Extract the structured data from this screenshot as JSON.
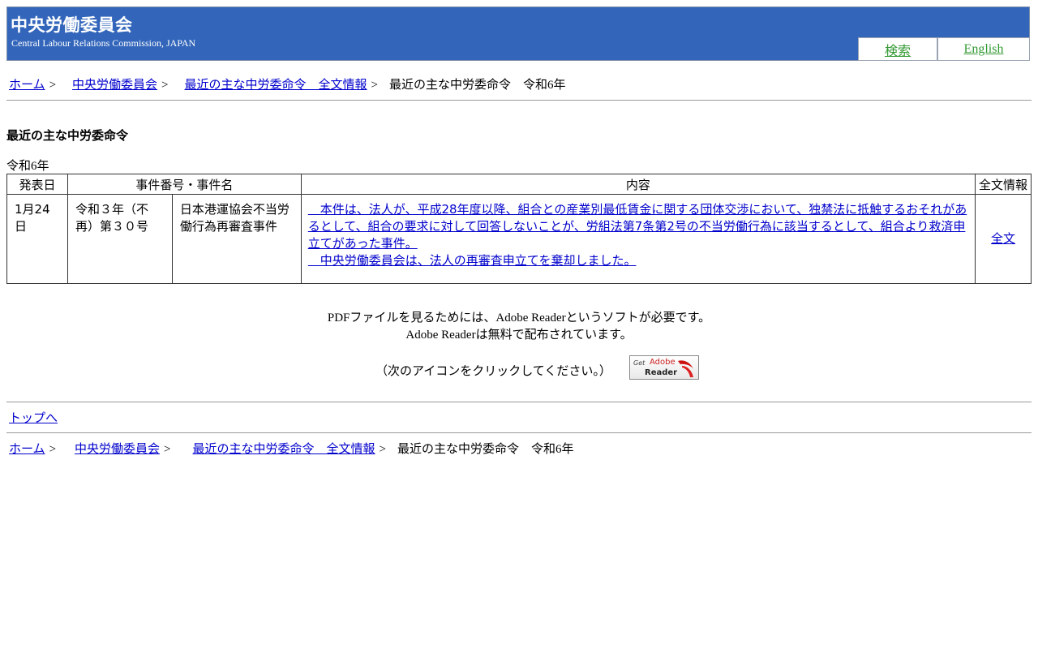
{
  "header": {
    "title": "中央労働委員会",
    "subtitle": "Central Labour Relations Commission, JAPAN",
    "search_label": "検索",
    "english_label": "English"
  },
  "breadcrumb": {
    "home": "ホーム",
    "commission": "中央労働委員会",
    "orders": "最近の主な中労委命令　全文情報",
    "current": "最近の主な中労委命令　令和6年",
    "separator": ">"
  },
  "page": {
    "heading": "最近の主な中労委命令",
    "year": "令和6年"
  },
  "table": {
    "headers": {
      "date": "発表日",
      "case": "事件番号・事件名",
      "content": "内容",
      "full_text": "全文情報"
    },
    "rows": [
      {
        "date": "1月24日",
        "case_number": "令和３年（不再）第３０号",
        "case_name": "日本港運協会不当労働行為再審査事件",
        "content_p1": "　本件は、法人が、平成28年度以降、組合との産業別最低賃金に関する団体交渉において、独禁法に抵触するおそれがあるとして、組合の要求に対して回答しないことが、労組法第7条第2号の不当労働行為に該当するとして、組合より救済申立てがあった事件。",
        "content_p2": "　中央労働委員会は、法人の再審査申立てを棄却しました。",
        "full_text_link": "全文"
      }
    ]
  },
  "pdf_note": {
    "line1": "PDFファイルを見るためには、Adobe Readerというソフトが必要です。",
    "line2": "Adobe Readerは無料で配布されています。",
    "click": "（次のアイコンをクリックしてください。）",
    "badge_get": "Get",
    "badge_brand": "Adobe",
    "badge_reader": "Reader"
  },
  "to_top": "トップへ"
}
